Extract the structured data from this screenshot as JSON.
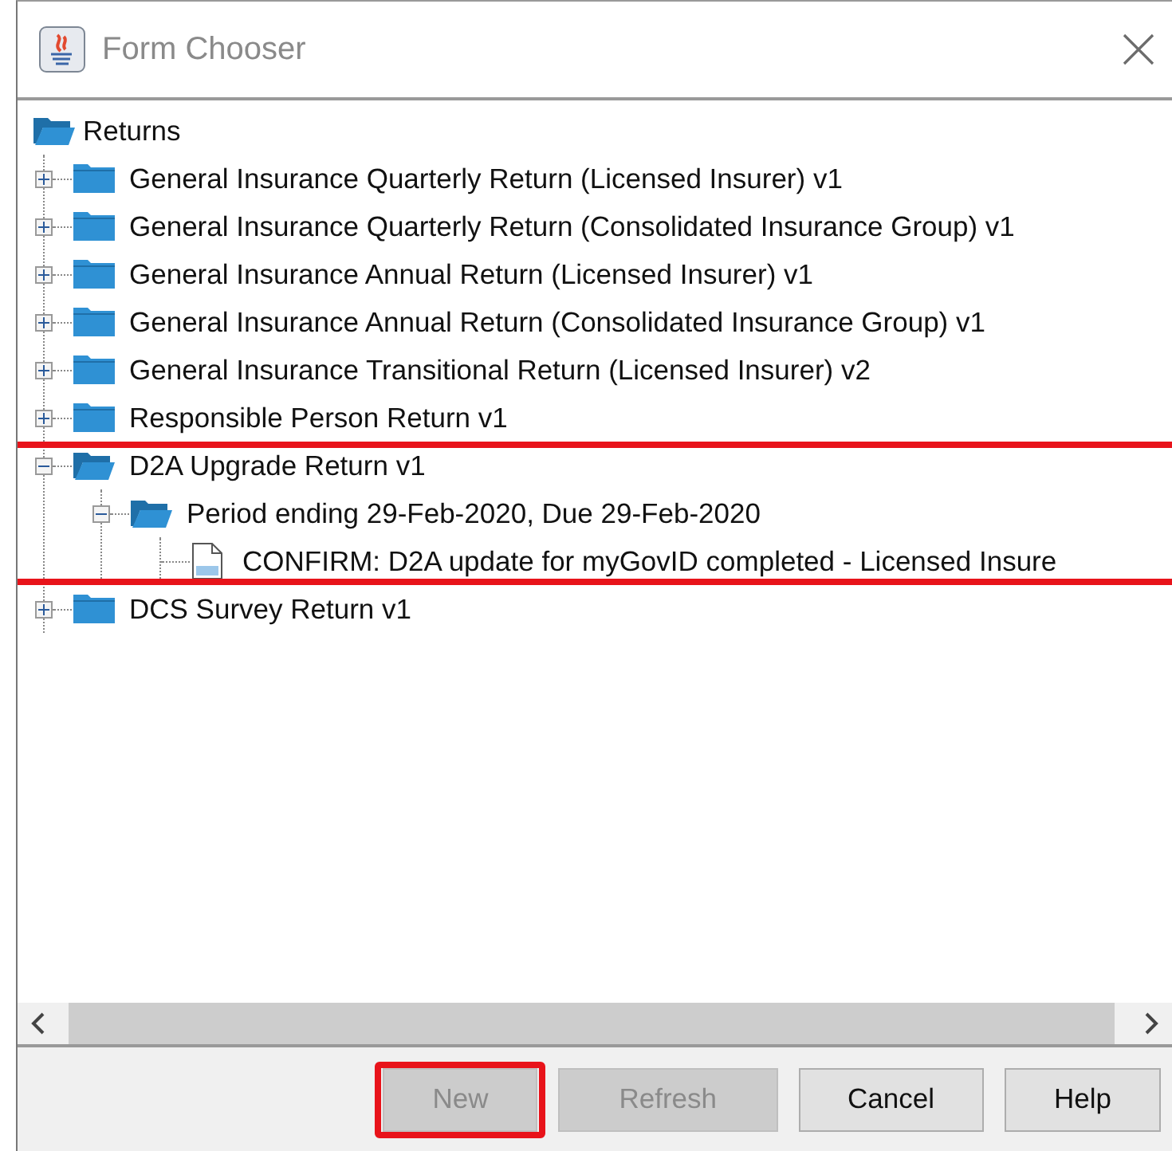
{
  "window": {
    "title": "Form Chooser"
  },
  "tree": {
    "label": "Returns",
    "kind": "folder",
    "expanded": true,
    "children": [
      {
        "label": "General Insurance Quarterly Return (Licensed Insurer) v1",
        "kind": "folder",
        "expanded": false,
        "highlighted": false
      },
      {
        "label": "General Insurance Quarterly Return (Consolidated Insurance Group) v1",
        "kind": "folder",
        "expanded": false,
        "highlighted": false
      },
      {
        "label": "General Insurance Annual Return (Licensed Insurer) v1",
        "kind": "folder",
        "expanded": false,
        "highlighted": false
      },
      {
        "label": "General Insurance Annual Return (Consolidated Insurance Group) v1",
        "kind": "folder",
        "expanded": false,
        "highlighted": false
      },
      {
        "label": "General Insurance Transitional Return (Licensed Insurer) v2",
        "kind": "folder",
        "expanded": false,
        "highlighted": false
      },
      {
        "label": "Responsible Person Return v1",
        "kind": "folder",
        "expanded": false,
        "highlighted": false
      },
      {
        "label": "D2A Upgrade Return v1",
        "kind": "folder",
        "expanded": true,
        "highlighted": true,
        "children": [
          {
            "label": "Period ending 29-Feb-2020, Due 29-Feb-2020",
            "kind": "folder",
            "expanded": true,
            "children": [
              {
                "label": "CONFIRM: D2A update for myGovID completed - Licensed Insure",
                "kind": "document"
              }
            ]
          }
        ]
      },
      {
        "label": "DCS Survey Return v1",
        "kind": "folder",
        "expanded": false,
        "highlighted": false
      }
    ]
  },
  "buttons": [
    {
      "label": "New",
      "disabled": true,
      "highlighted": true
    },
    {
      "label": "Refresh",
      "disabled": true,
      "highlighted": false
    },
    {
      "label": "Cancel",
      "disabled": false,
      "highlighted": false
    },
    {
      "label": "Help",
      "disabled": false,
      "highlighted": false
    }
  ]
}
